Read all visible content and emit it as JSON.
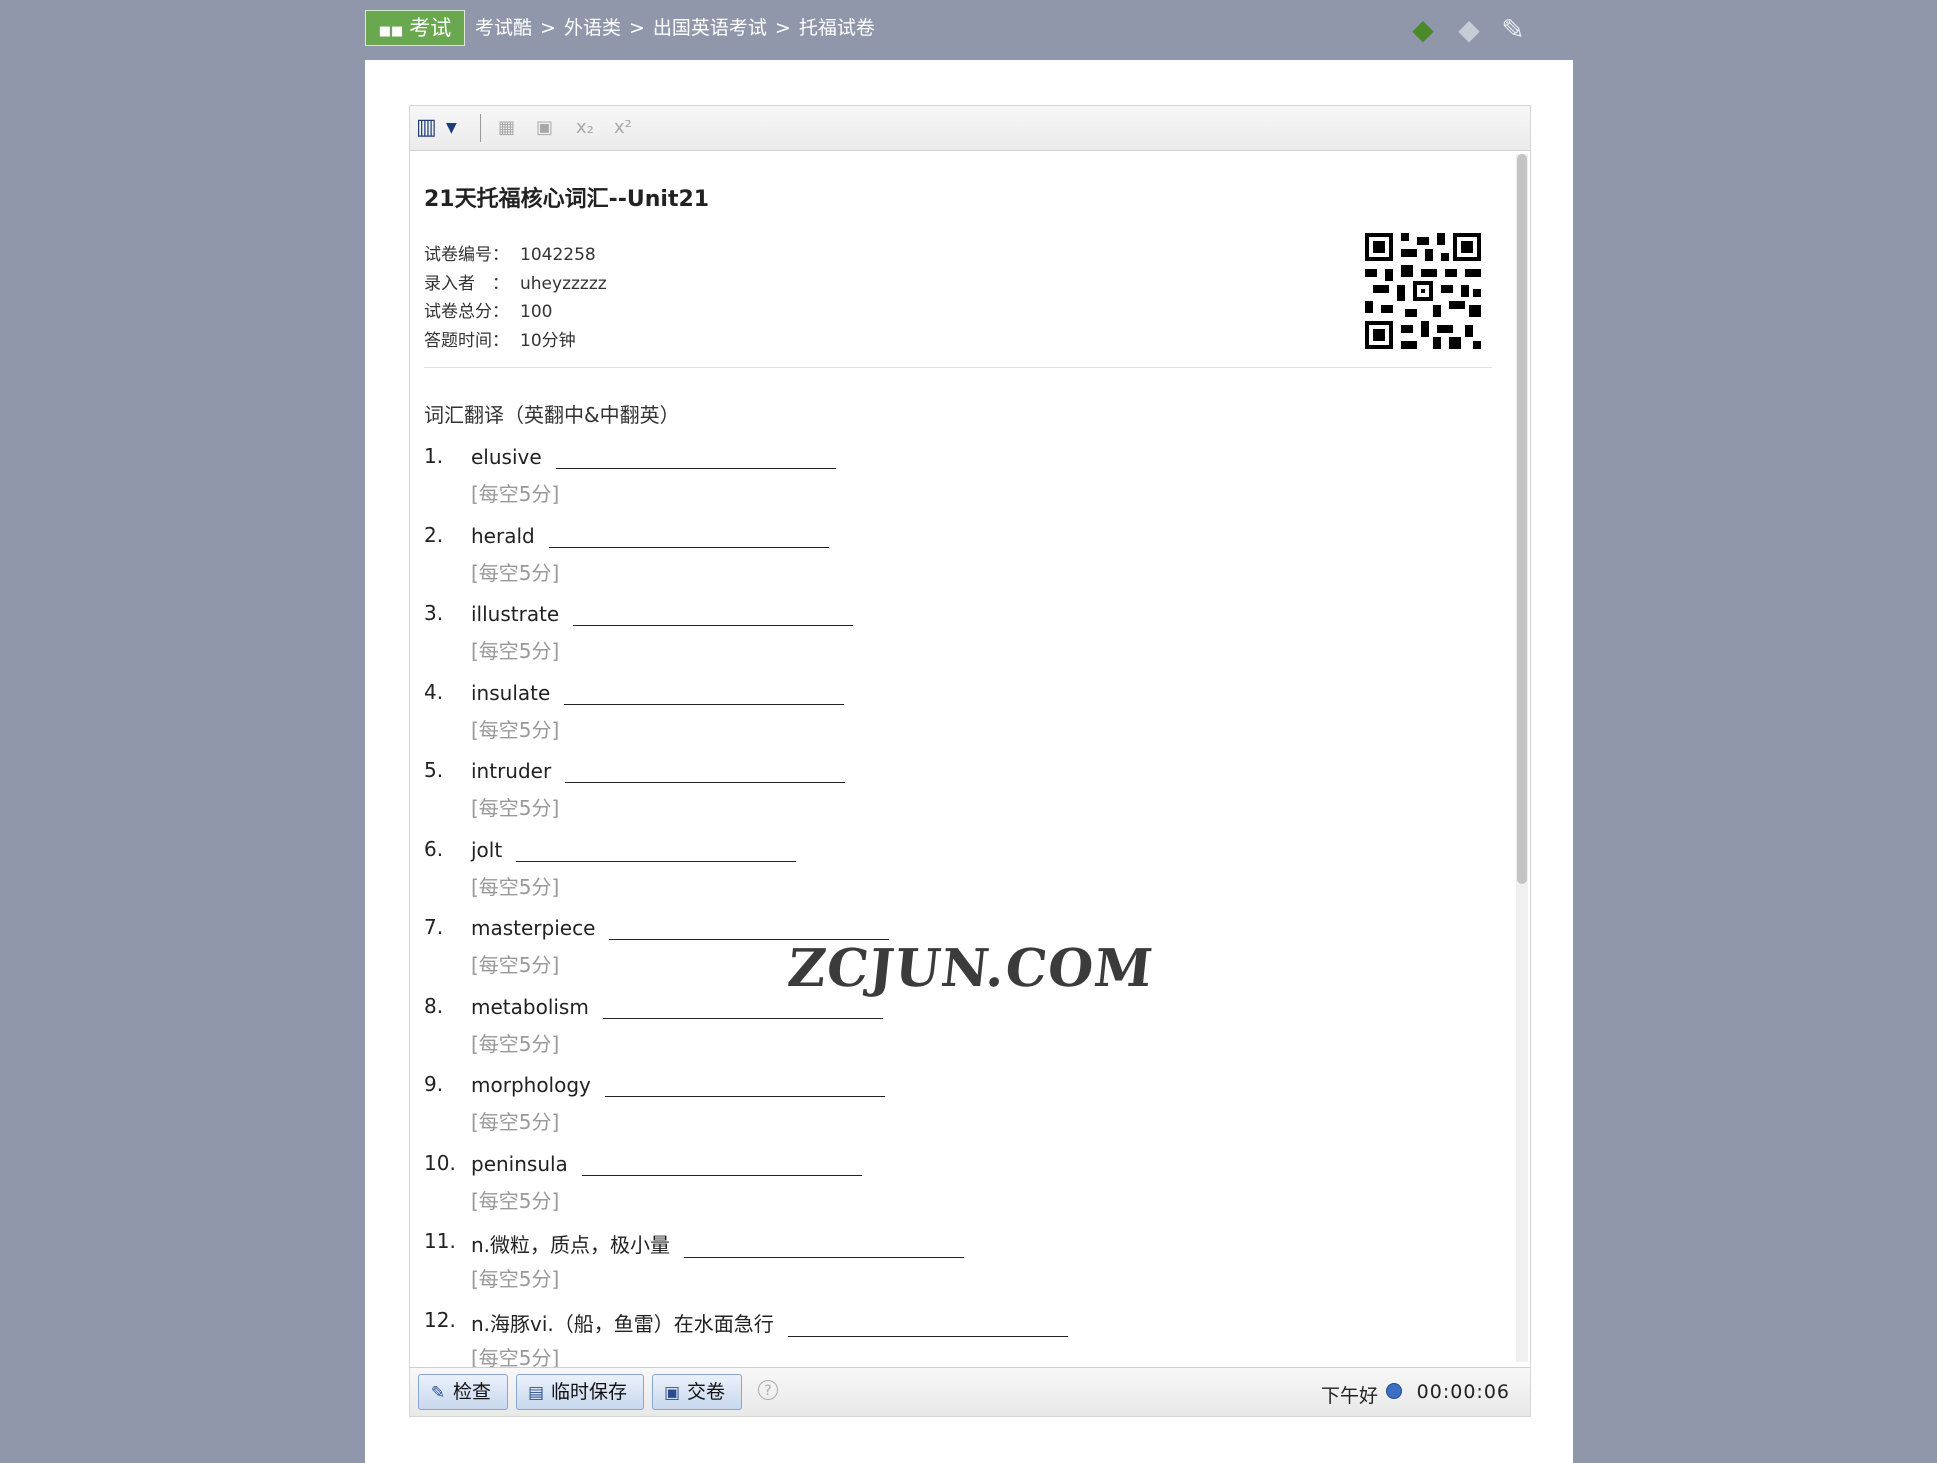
{
  "topbar": {
    "exam_label": "考试",
    "breadcrumb": [
      "考试酷",
      "外语类",
      "出国英语考试",
      "托福试卷"
    ],
    "separator": ">"
  },
  "toolbar": {
    "sub_label": "x₂",
    "sup_label": "x²"
  },
  "paper": {
    "title": "21天托福核心词汇--Unit21",
    "meta": [
      {
        "key": "试卷编号：",
        "value": "1042258"
      },
      {
        "key": "录入者　：",
        "value": "uheyzzzzz"
      },
      {
        "key": "试卷总分：",
        "value": "100"
      },
      {
        "key": "答题时间：",
        "value": "10分钟"
      }
    ],
    "section": "词汇翻译（英翻中&中翻英）",
    "questions": [
      {
        "num": "1.",
        "text": "elusive",
        "score": "[每空5分]"
      },
      {
        "num": "2.",
        "text": "herald",
        "score": "[每空5分]"
      },
      {
        "num": "3.",
        "text": "illustrate",
        "score": "[每空5分]"
      },
      {
        "num": "4.",
        "text": "insulate",
        "score": "[每空5分]"
      },
      {
        "num": "5.",
        "text": "intruder",
        "score": "[每空5分]"
      },
      {
        "num": "6.",
        "text": "jolt",
        "score": "[每空5分]"
      },
      {
        "num": "7.",
        "text": "masterpiece",
        "score": "[每空5分]"
      },
      {
        "num": "8.",
        "text": "metabolism",
        "score": "[每空5分]"
      },
      {
        "num": "9.",
        "text": "morphology",
        "score": "[每空5分]"
      },
      {
        "num": "10.",
        "text": "peninsula",
        "score": "[每空5分]"
      },
      {
        "num": "11.",
        "text": "n.微粒，质点，极小量",
        "score": "[每空5分]"
      },
      {
        "num": "12.",
        "text": "n.海豚vi.（船，鱼雷）在水面急行",
        "score": "[每空5分]"
      }
    ]
  },
  "bottombar": {
    "check_label": "检查",
    "save_label": "临时保存",
    "submit_label": "交卷",
    "help_label": "?",
    "greeting": "下午好",
    "timer": "00:00:06"
  },
  "watermark": "ZCJUN.COM"
}
